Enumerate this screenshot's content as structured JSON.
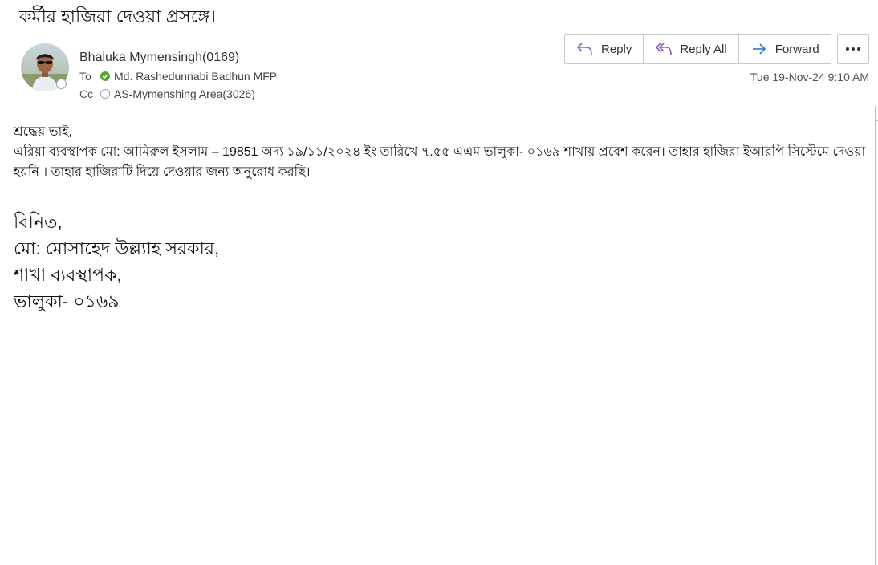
{
  "email": {
    "subject": "কর্মীর হাজিরা দেওয়া প্রসঙ্গে।",
    "sender": {
      "name": "Bhaluka Mymensingh(0169)",
      "avatar": "user-avatar-photo"
    },
    "to": {
      "label": "To",
      "name": "Md. Rashedunnabi Badhun MFP",
      "status_color": "#5aa52f"
    },
    "cc": {
      "label": "Cc",
      "name": "AS-Mymenshing Area(3026)"
    },
    "timestamp": "Tue 19-Nov-24 9:10 AM"
  },
  "toolbar": {
    "reply_label": "Reply",
    "reply_all_label": "Reply All",
    "forward_label": "Forward",
    "more_icon": "more-horizontal-icon",
    "icon_color_reply": "#8a5fb8",
    "icon_color_forward": "#2b79c2"
  },
  "body": {
    "greeting": "শ্রদ্ধেয় ভাই,",
    "paragraph": "এরিয়া ব্যবস্থাপক মো: আমিরুল ইসলাম – 19851 অদ্য ১৯/১১/২০২৪ ইং তারিখে ৭.৫৫ এএম ভালুকা- ০১৬৯ শাখায় প্রবেশ করেন। তাহার হাজিরা ইআরপি সিস্টেমে দেওয়া হয়নি । তাহার হাজিরাটি দিয়ে দেওয়ার জন্য অনুরোধ করছি।"
  },
  "signature": {
    "line1": "বিনিত,",
    "line2": "মো: মোসাহেদ উল্ল্যাহ সরকার,",
    "line3": "শাখা ব্যবস্থাপক,",
    "line4": "ভালুকা- ০১৬৯"
  }
}
